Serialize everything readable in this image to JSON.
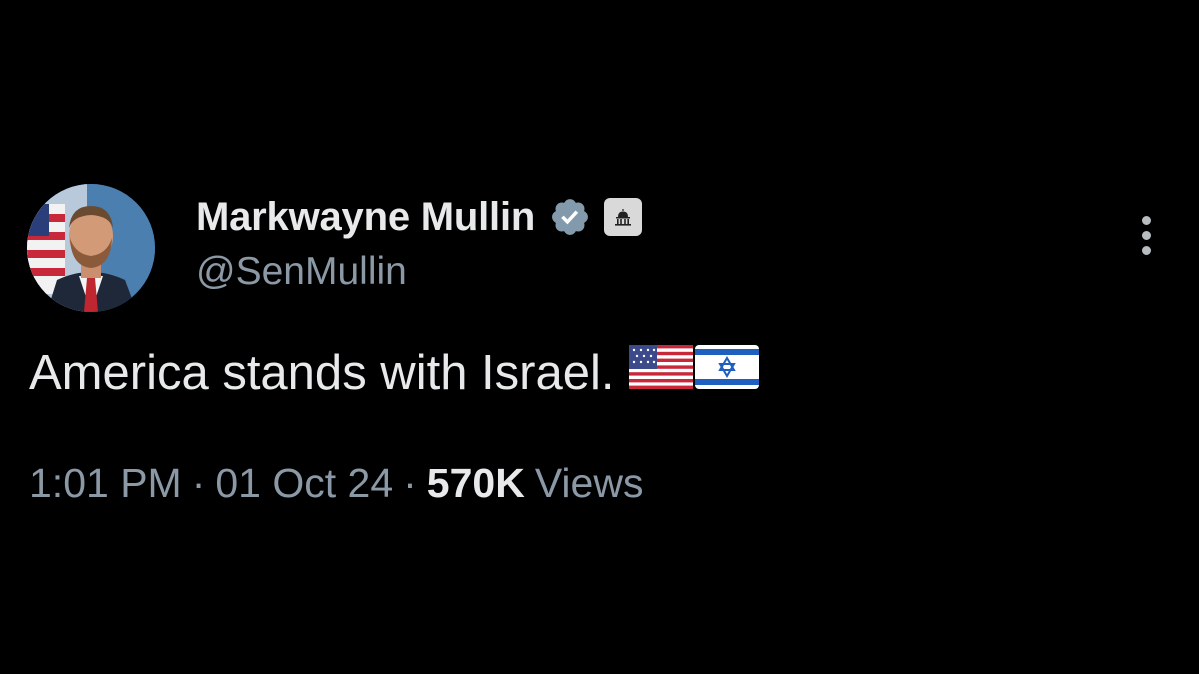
{
  "tweet": {
    "author": {
      "display_name": "Markwayne Mullin",
      "handle": "@SenMullin",
      "verified_badge_icon": "verified-badge-icon",
      "affiliation_icon": "capitol-building-icon",
      "avatar": "profile-photo"
    },
    "text": "America stands with Israel.",
    "emoji": [
      "us-flag-icon",
      "israel-flag-icon"
    ],
    "meta": {
      "time": "1:01 PM",
      "separator": "·",
      "date": "01 Oct 24",
      "views_count": "570K",
      "views_label": "Views"
    },
    "more_icon": "more-vertical-icon"
  },
  "colors": {
    "background": "#000000",
    "primary_text": "#e7e9ea",
    "secondary_text": "#8b98a5",
    "verified_blue": "#829aab",
    "badge_gray": "#d9d9d9"
  }
}
